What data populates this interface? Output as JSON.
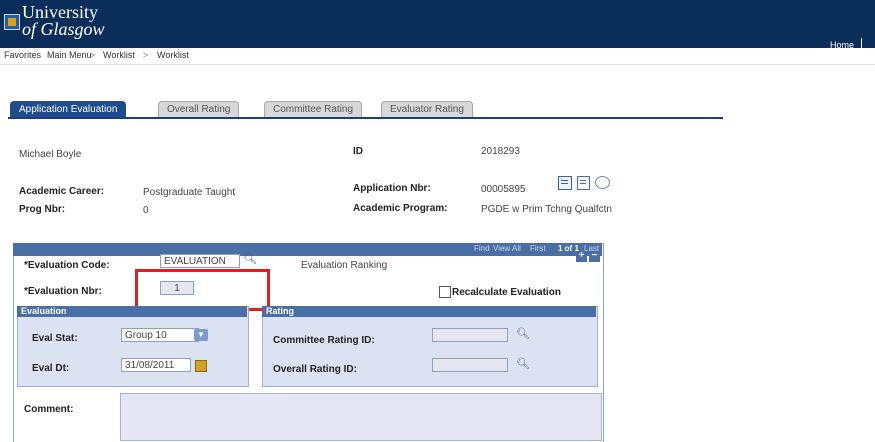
{
  "header": {
    "logo_line1": "University",
    "logo_line2": "of Glasgow",
    "home": "Home"
  },
  "nav": {
    "items": [
      "Favorites",
      "Main Menu",
      "Worklist",
      "Worklist"
    ],
    "separator": ">"
  },
  "tabs": [
    {
      "label": "Application Evaluation",
      "active": true
    },
    {
      "label": "Overall Rating",
      "active": false
    },
    {
      "label": "Committee Rating",
      "active": false
    },
    {
      "label": "Evaluator Rating",
      "active": false
    }
  ],
  "person": {
    "name": "Michael Boyle",
    "id_label": "ID",
    "id_value": "2018293"
  },
  "details": {
    "career_label": "Academic Career:",
    "career_value": "Postgraduate Taught",
    "prog_nbr_label": "Prog Nbr:",
    "prog_nbr_value": "0",
    "app_nbr_label": "Application Nbr:",
    "app_nbr_value": "00005895",
    "program_label": "Academic Program:",
    "program_value": "PGDE w Prim Tchng Qualfctn"
  },
  "panel_nav": {
    "find": "Find",
    "view_all": "View All",
    "first": "First",
    "count": "1 of 1",
    "last": "Last"
  },
  "evaluation": {
    "code_label": "*Evaluation Code:",
    "code_value": "EVALUATION",
    "code_desc": "Evaluation Ranking",
    "nbr_label": "*Evaluation Nbr:",
    "nbr_value": "1",
    "recalc_label": "Recalculate Evaluation",
    "recalc_checked": false
  },
  "eval_group": {
    "title": "Evaluation",
    "stat_label": "Eval Stat:",
    "stat_value": "Group 10",
    "dt_label": "Eval Dt:",
    "dt_value": "31/08/2011"
  },
  "rating_group": {
    "title": "Rating",
    "committee_label": "Committee Rating ID:",
    "overall_label": "Overall Rating ID:"
  },
  "comment": {
    "label": "Comment:"
  },
  "colors": {
    "header_bg": "#0b2d5a",
    "tab_active": "#1f4c8f",
    "highlight": "#e02020"
  }
}
